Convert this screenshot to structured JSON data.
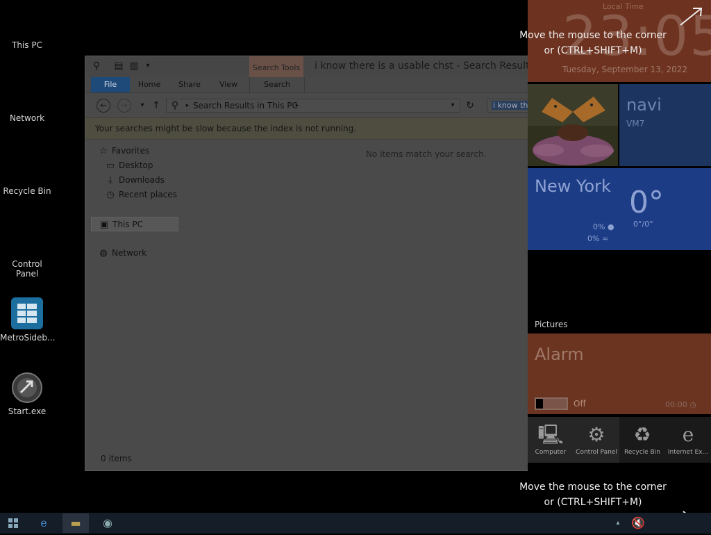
{
  "desktop": {
    "icons": [
      {
        "label": "This PC",
        "icon": "pc-icon"
      },
      {
        "label": "Network",
        "icon": "network-icon"
      },
      {
        "label": "Recycle Bin",
        "icon": "recycle-bin-icon"
      },
      {
        "label": "Control Panel",
        "icon": "control-panel-icon"
      },
      {
        "label": "MetroSideb...",
        "icon": "metro-sidebar-icon"
      },
      {
        "label": "Start.exe",
        "icon": "start-exe-icon"
      }
    ]
  },
  "explorer": {
    "context_tab": "Search Tools",
    "title": "i know there is a usable chst - Search Results in",
    "ribbon_tabs": [
      "File",
      "Home",
      "Share",
      "View",
      "Search"
    ],
    "address": "Search Results in This PC",
    "search_query": "i know the",
    "info_bar": "Your searches might be slow because the index is not running.",
    "nav": {
      "favorites": "Favorites",
      "favorites_items": [
        "Desktop",
        "Downloads",
        "Recent places"
      ],
      "this_pc": "This PC",
      "network": "Network"
    },
    "empty_message": "No items match your search.",
    "status": "0 items"
  },
  "sidebar": {
    "clock": {
      "label": "Local Time",
      "time": "23:05",
      "date": "Tuesday, September 13, 2022"
    },
    "user": {
      "name": "navi",
      "host": "VM7"
    },
    "weather": {
      "city": "New York",
      "temp": "0°",
      "range": "0°/0°",
      "precip": "0%",
      "wind": "0%"
    },
    "pictures_label": "Pictures",
    "alarm": {
      "title": "Alarm",
      "state": "Off",
      "time": "00:00"
    },
    "shortcuts": [
      {
        "label": "Computer",
        "icon": "computer-icon"
      },
      {
        "label": "Control Panel",
        "icon": "gear-icon"
      },
      {
        "label": "Recycle Bin",
        "icon": "recycle-bin-icon"
      },
      {
        "label": "Internet Ex...",
        "icon": "internet-explorer-icon"
      }
    ],
    "hint_top": [
      "Move the mouse to the corner",
      "or (CTRL+SHIFT+M)"
    ],
    "hint_bottom": [
      "Move the mouse to the corner",
      "or (CTRL+SHIFT+M)"
    ]
  },
  "taskbar": {
    "buttons": [
      "start-button",
      "internet-explorer",
      "file-explorer",
      "start-exe"
    ]
  }
}
